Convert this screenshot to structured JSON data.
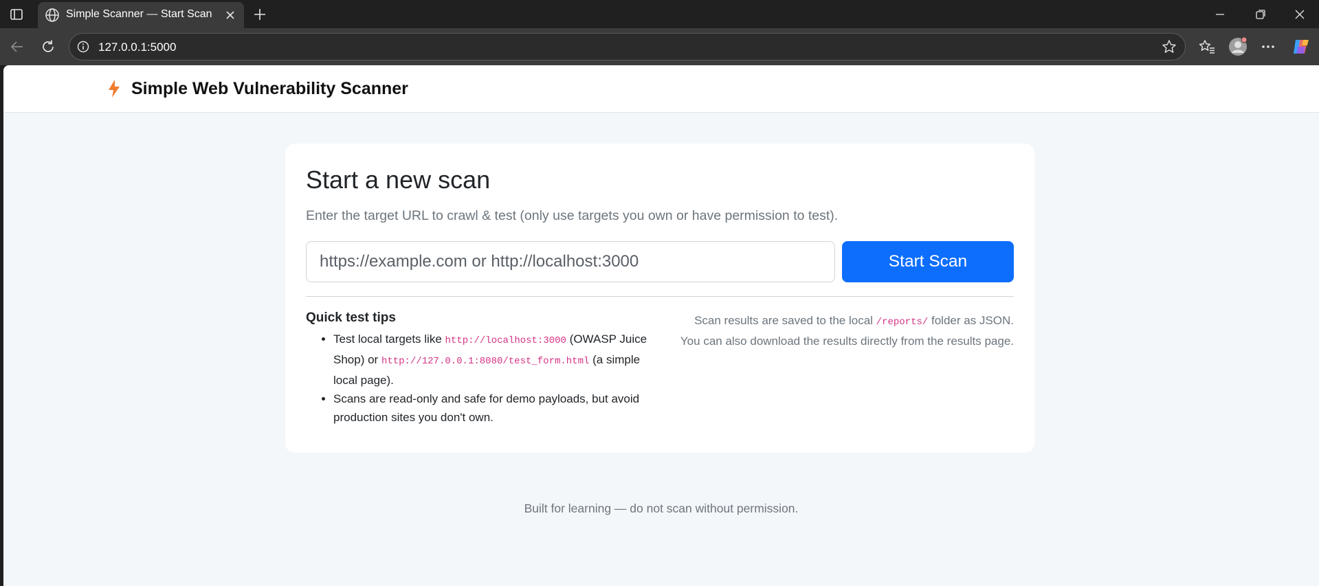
{
  "browser": {
    "tab_title": "Simple Scanner — Start Scan",
    "url": "127.0.0.1:5000",
    "icons": [
      "tab-actions-icon",
      "globe-icon",
      "close-icon",
      "plus-icon",
      "minimize-icon",
      "restore-icon",
      "close-window-icon",
      "back-icon",
      "refresh-icon",
      "info-icon",
      "star-icon",
      "favorites-icon",
      "profile-icon",
      "more-icon",
      "copilot-icon"
    ]
  },
  "navbar": {
    "brand_icon": "lightning-icon",
    "brand": "Simple Web Vulnerability Scanner"
  },
  "scan_card": {
    "title": "Start a new scan",
    "subtitle": "Enter the target URL to crawl & test (only use targets you own or have permission to test).",
    "input_placeholder": "https://example.com or http://localhost:3000",
    "input_value": "",
    "button_label": "Start Scan",
    "tips": {
      "title": "Quick test tips",
      "item1_a": "Test local targets like ",
      "item1_code1": "http://localhost:3000",
      "item1_b": " (OWASP Juice Shop) or ",
      "item1_code2": "http://127.0.0.1:8080/test_form.html",
      "item1_c": " (a simple local page).",
      "item2": "Scans are read-only and safe for demo payloads, but avoid production sites you don't own."
    },
    "info": {
      "line1_a": "Scan results are saved to the local ",
      "line1_code": "/reports/",
      "line1_b": " folder as JSON.",
      "line2": "You can also download the results directly from the results page."
    }
  },
  "footer": {
    "text": "Built for learning — do not scan without permission."
  },
  "colors": {
    "primary": "#0d6efd",
    "code": "#d63384",
    "muted": "#6c757d",
    "page_bg": "#f4f7fa",
    "brand_icon": "#f07d2e"
  }
}
